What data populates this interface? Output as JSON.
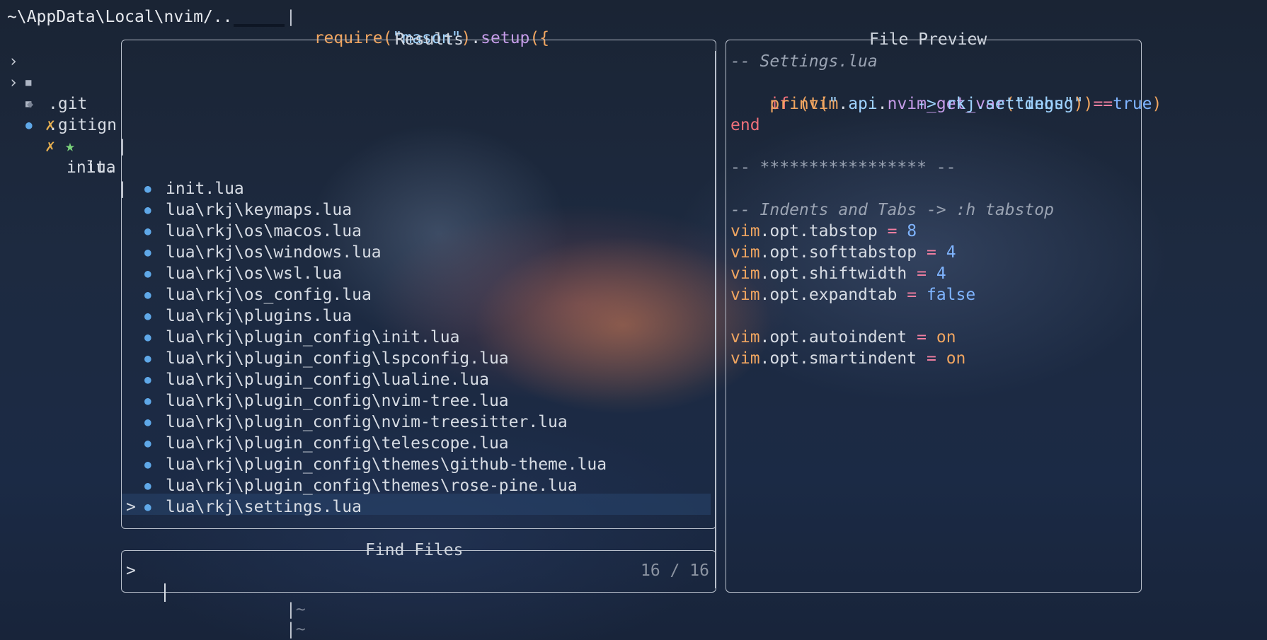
{
  "top_bar": {
    "path": "~\\AppData\\Local\\nvim/..",
    "code_require": "require",
    "code_paren_open": "(",
    "code_string": "\"mason\"",
    "code_paren_close": ")",
    "code_dot": ".",
    "code_setup": "setup",
    "code_open": "({"
  },
  "tree": {
    "items": [
      {
        "chevron": "›",
        "icon": "folder-icon",
        "glyph": "■",
        "git": "",
        "star": "",
        "name": ".git"
      },
      {
        "chevron": "›",
        "icon": "folder-icon",
        "glyph": "■",
        "git": "✗",
        "star": "★",
        "name": "lua"
      },
      {
        "chevron": "",
        "icon": "gitignore-icon",
        "glyph": "◆",
        "git": "",
        "star": "",
        "name": ".gitign"
      },
      {
        "chevron": "",
        "icon": "lua-file-icon",
        "glyph": "●",
        "git": "✗",
        "star": "",
        "name": "init."
      }
    ]
  },
  "results": {
    "title": "Results",
    "files": [
      "init.lua",
      "lua\\rkj\\keymaps.lua",
      "lua\\rkj\\os\\macos.lua",
      "lua\\rkj\\os\\windows.lua",
      "lua\\rkj\\os\\wsl.lua",
      "lua\\rkj\\os_config.lua",
      "lua\\rkj\\plugins.lua",
      "lua\\rkj\\plugin_config\\init.lua",
      "lua\\rkj\\plugin_config\\lspconfig.lua",
      "lua\\rkj\\plugin_config\\lualine.lua",
      "lua\\rkj\\plugin_config\\nvim-tree.lua",
      "lua\\rkj\\plugin_config\\nvim-treesitter.lua",
      "lua\\rkj\\plugin_config\\telescope.lua",
      "lua\\rkj\\plugin_config\\themes\\github-theme.lua",
      "lua\\rkj\\plugin_config\\themes\\rose-pine.lua",
      "lua\\rkj\\settings.lua"
    ],
    "selected_marker": ">",
    "file_glyph": "●"
  },
  "find": {
    "title": "Find Files",
    "prompt": ">",
    "query": "",
    "count": "16 / 16"
  },
  "preview": {
    "title": "File Preview",
    "l1": "-- Settings.lua",
    "l2_if": "if",
    "l2_p1": " (",
    "l2_vim": "vim",
    "l2_dot1": ".",
    "l2_api": "api",
    "l2_dot2": ".",
    "l2_fn": "nvim_get_var",
    "l2_p2": "(",
    "l2_str": "\"debug\"",
    "l2_p3": ")",
    "l2_eq": "==",
    "l2_true": "true",
    "l2_p4": ")",
    "l3_print": "print",
    "l3_p1": "(",
    "l3_str": "\"        -> rkj.settings\"",
    "l3_p2": ")",
    "l4_end": "end",
    "l6": "-- ***************** --",
    "l8": "-- Indents and Tabs -> :h tabstop",
    "opts": [
      {
        "name": "tabstop",
        "value": "8",
        "kind": "num"
      },
      {
        "name": "softtabstop",
        "value": "4",
        "kind": "num"
      },
      {
        "name": "shiftwidth",
        "value": "4",
        "kind": "num"
      },
      {
        "name": "expandtab",
        "value": "false",
        "kind": "bool"
      }
    ],
    "opts2": [
      {
        "name": "autoindent",
        "value": "on"
      },
      {
        "name": "smartindent",
        "value": "on"
      }
    ],
    "vim": "vim",
    "opt": "opt",
    "dot": ".",
    "assign": " = "
  },
  "buffer_tildes": [
    "~",
    "~"
  ],
  "separator_char": "|"
}
